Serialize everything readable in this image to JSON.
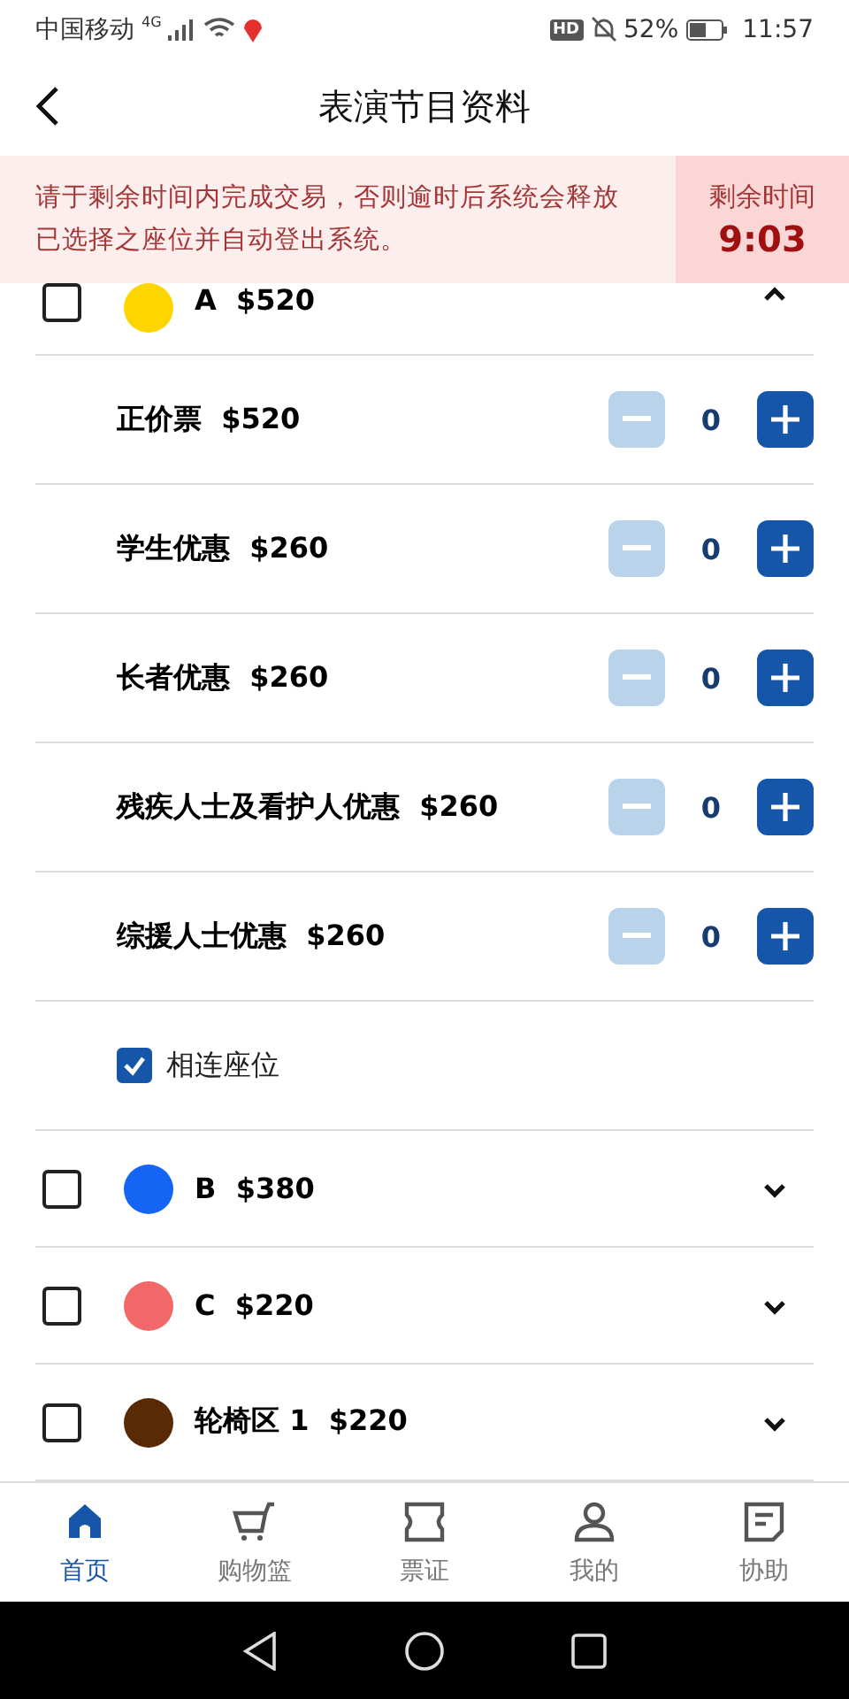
{
  "status_bar": {
    "carrier": "中国移动",
    "network": "4G",
    "hd": "HD",
    "battery": "52%",
    "time": "11:57"
  },
  "header": {
    "title": "表演节目资料"
  },
  "notice": {
    "message": "请于剩余时间内完成交易，否则逾时后系统会释放已选择之座位并自动登出系统。",
    "timer_label": "剩余时间",
    "timer": "9:03"
  },
  "sections": [
    {
      "zone": "A",
      "price": "$520",
      "color": "#ffd500",
      "checked": false,
      "expanded": true,
      "tickets": [
        {
          "name": "正价票",
          "price": "$520",
          "count": "0",
          "minus_disabled": true
        },
        {
          "name": "学生优惠",
          "price": "$260",
          "count": "0",
          "minus_disabled": true
        },
        {
          "name": "长者优惠",
          "price": "$260",
          "count": "0",
          "minus_disabled": true
        },
        {
          "name": "残疾人士及看护人优惠",
          "price": "$260",
          "count": "0",
          "minus_disabled": true
        },
        {
          "name": "综援人士优惠",
          "price": "$260",
          "count": "0",
          "minus_disabled": true
        }
      ],
      "adjacent": {
        "label": "相连座位",
        "checked": true
      }
    },
    {
      "zone": "B",
      "price": "$380",
      "color": "#1565f5",
      "checked": false,
      "expanded": false
    },
    {
      "zone": "C",
      "price": "$220",
      "color": "#f26767",
      "checked": false,
      "expanded": false
    },
    {
      "zone": "轮椅区 1",
      "price": "$220",
      "color": "#5a2a05",
      "checked": false,
      "expanded": false
    }
  ],
  "bottom_nav": [
    {
      "label": "首页",
      "kind": "home",
      "selected": true
    },
    {
      "label": "购物篮",
      "kind": "cart",
      "selected": false
    },
    {
      "label": "票证",
      "kind": "ticket",
      "selected": false
    },
    {
      "label": "我的",
      "kind": "person",
      "selected": false
    },
    {
      "label": "协助",
      "kind": "help",
      "selected": false
    }
  ]
}
